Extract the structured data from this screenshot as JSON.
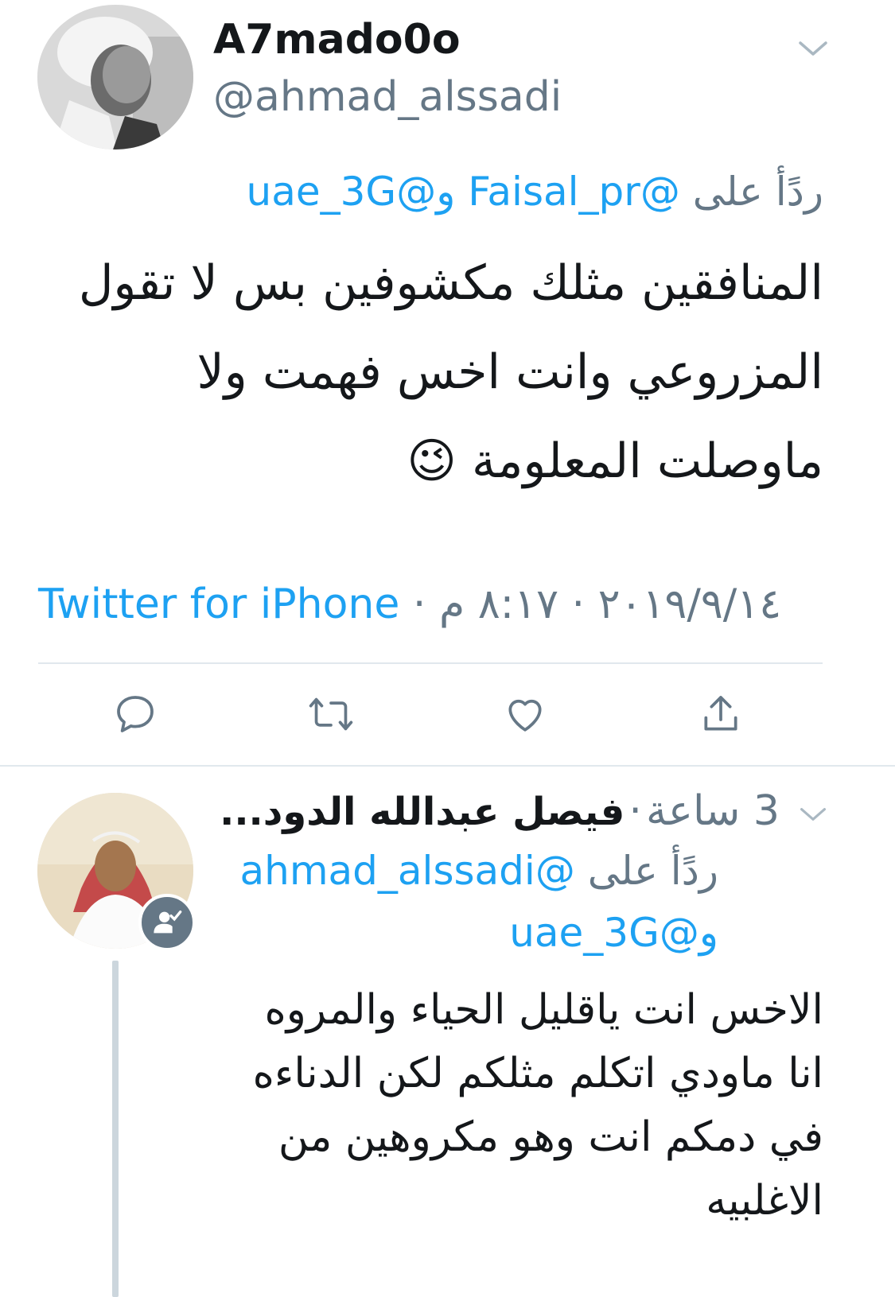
{
  "tweet": {
    "display_name": "A7mado0o",
    "handle": "@ahmad_alssadi",
    "reply_prefix": "ردًأ على",
    "reply_mention_1": "@Faisal_pr",
    "reply_conj": "و",
    "reply_mention_2": "@uae_3G",
    "body_line_1": "المنافقين  مثلك مكشوفين بس لا تقول",
    "body_line_2": "المزروعي وانت اخس فهمت ولا",
    "body_line_3": "ماوصلت المعلومة",
    "emoji": "😉",
    "time": "٨:١٧ م",
    "date": "٢٠١٩/٩/١٤",
    "separator": "·",
    "source": "Twitter for iPhone"
  },
  "actions": {
    "reply_icon": "reply-bubble-icon",
    "retweet_icon": "retweet-icon",
    "like_icon": "heart-icon",
    "share_icon": "share-icon"
  },
  "reply_tweet": {
    "display_name": "فيصل عبدالله الدود...",
    "time_ago": "3 ساعة",
    "separator": "·",
    "reply_prefix": "ردًأ على",
    "reply_mention_1": "@ahmad_alssadi",
    "reply_conj": "و",
    "reply_mention_2": "@uae_3G",
    "body_line_1": "الاخس  انت ياقليل الحياء والمروه",
    "body_line_2": "انا ماودي اتكلم مثلكم لكن الدناءه",
    "body_line_3": "في دمكم  انت وهو مكروهين من",
    "body_line_4": "الاغلبيه",
    "follow_badge_icon": "follows-you-icon"
  },
  "colors": {
    "accent": "#1da1f2",
    "secondary_text": "#657786",
    "divider": "#e1e8ed",
    "thread_line": "#ccd6dd"
  }
}
